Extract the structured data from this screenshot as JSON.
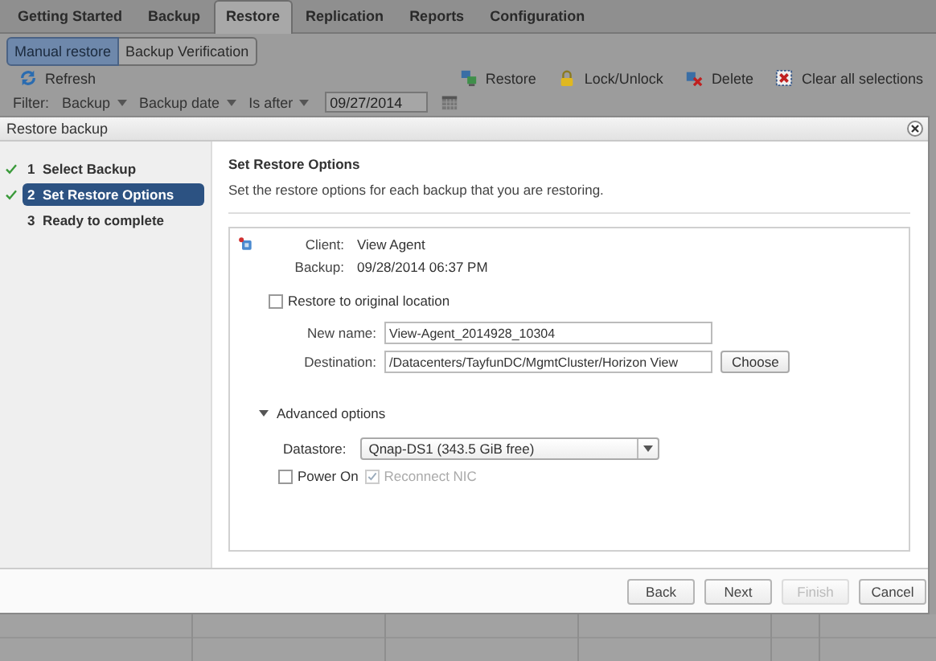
{
  "tabs": [
    {
      "label": "Getting Started",
      "selected": false
    },
    {
      "label": "Backup",
      "selected": false
    },
    {
      "label": "Restore",
      "selected": true
    },
    {
      "label": "Replication",
      "selected": false
    },
    {
      "label": "Reports",
      "selected": false
    },
    {
      "label": "Configuration",
      "selected": false
    }
  ],
  "subtabs": [
    {
      "label": "Manual restore",
      "selected": true
    },
    {
      "label": "Backup Verification",
      "selected": false
    }
  ],
  "toolbar": {
    "left": [
      {
        "label": "Refresh"
      }
    ],
    "right": [
      {
        "label": "Restore"
      },
      {
        "label": "Lock/Unlock"
      },
      {
        "label": "Delete"
      },
      {
        "label": "Clear all selections"
      }
    ]
  },
  "filter": {
    "label": "Filter:",
    "dropdowns": [
      "Backup",
      "Backup date",
      "Is after"
    ],
    "date": "09/27/2014"
  },
  "dialog": {
    "title": "Restore backup",
    "steps": [
      {
        "number": "1",
        "label": "Select Backup",
        "done": true,
        "selected": false
      },
      {
        "number": "2",
        "label": "Set Restore Options",
        "done": true,
        "selected": true
      },
      {
        "number": "3",
        "label": "Ready to complete",
        "done": false,
        "selected": false
      }
    ],
    "heading": "Set Restore Options",
    "description": "Set the restore options for each backup that you are restoring.",
    "client_label": "Client:",
    "client": "View Agent",
    "backup_label": "Backup:",
    "backup": "09/28/2014 06:37 PM",
    "restore_original": {
      "label": "Restore to original location",
      "checked": false
    },
    "new_name": {
      "label": "New name:",
      "value": "View-Agent_2014928_10304"
    },
    "destination": {
      "label": "Destination:",
      "value": "/Datacenters/TayfunDC/MgmtCluster/Horizon View",
      "button": "Choose"
    },
    "advanced": {
      "label": "Advanced options",
      "expanded": true
    },
    "datastore": {
      "label": "Datastore:",
      "value": "Qnap-DS1 (343.5 GiB free)"
    },
    "power_on": {
      "label": "Power On",
      "checked": false,
      "disabled": false
    },
    "reconnect_nic": {
      "label": "Reconnect NIC",
      "checked": true,
      "disabled": true
    },
    "buttons": [
      {
        "label": "Back",
        "disabled": false
      },
      {
        "label": "Next",
        "disabled": false
      },
      {
        "label": "Finish",
        "disabled": true
      },
      {
        "label": "Cancel",
        "disabled": false
      }
    ]
  }
}
